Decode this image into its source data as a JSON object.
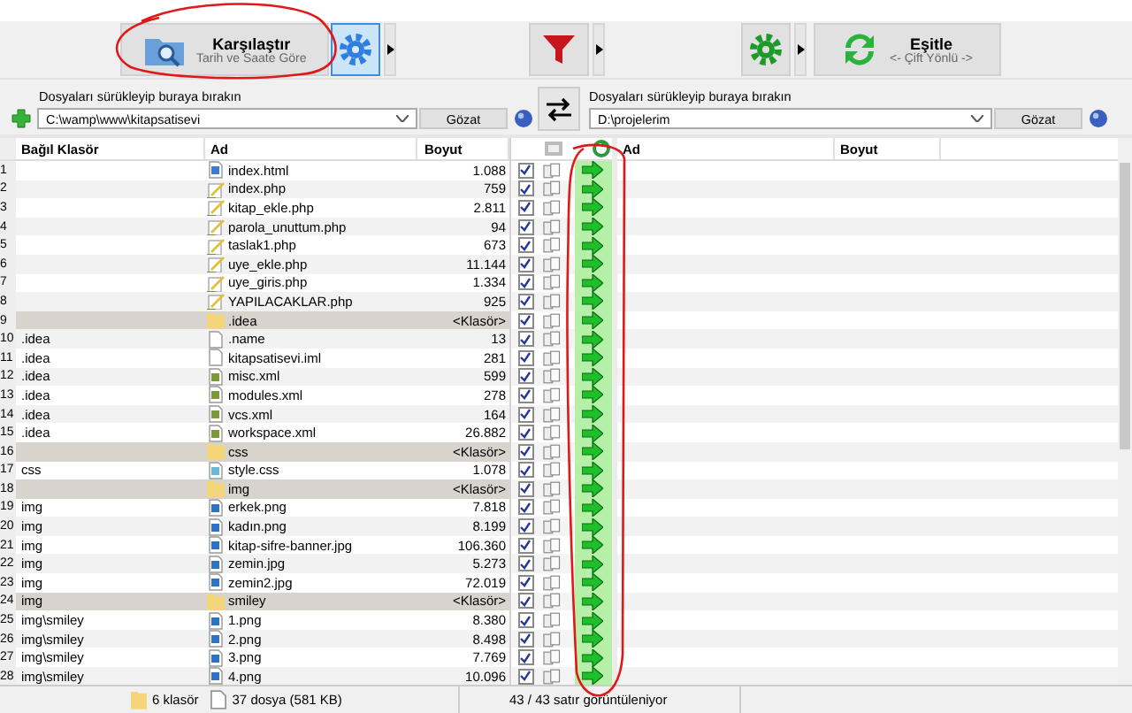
{
  "toolbar": {
    "compare": {
      "title": "Karşılaştır",
      "subtitle": "Tarih ve Saate Göre"
    },
    "sync": {
      "title": "Eşitle",
      "subtitle": "<- Çift Yönlü ->"
    }
  },
  "left_folder": {
    "label": "Dosyaları sürükleyip buraya bırakın",
    "path": "C:\\wamp\\www\\kitapsatisevi",
    "browse": "Gözat"
  },
  "right_folder": {
    "label": "Dosyaları sürükleyip buraya bırakın",
    "path": "D:\\projelerim",
    "browse": "Gözat"
  },
  "left_columns": [
    "Bağıl Klasör",
    "Ad",
    "Boyut"
  ],
  "right_columns": [
    "Ad",
    "Boyut"
  ],
  "rows": [
    {
      "number": "1",
      "folder": "",
      "name": "index.html",
      "size": "1.088",
      "kind": "html",
      "checked": true
    },
    {
      "number": "2",
      "folder": "",
      "name": "index.php",
      "size": "759",
      "kind": "php",
      "checked": true
    },
    {
      "number": "3",
      "folder": "",
      "name": "kitap_ekle.php",
      "size": "2.811",
      "kind": "php",
      "checked": true
    },
    {
      "number": "4",
      "folder": "",
      "name": "parola_unuttum.php",
      "size": "94",
      "kind": "php",
      "checked": true
    },
    {
      "number": "5",
      "folder": "",
      "name": "taslak1.php",
      "size": "673",
      "kind": "php",
      "checked": true
    },
    {
      "number": "6",
      "folder": "",
      "name": "uye_ekle.php",
      "size": "11.144",
      "kind": "php",
      "checked": true
    },
    {
      "number": "7",
      "folder": "",
      "name": "uye_giris.php",
      "size": "1.334",
      "kind": "php",
      "checked": true
    },
    {
      "number": "8",
      "folder": "",
      "name": "YAPILACAKLAR.php",
      "size": "925",
      "kind": "php",
      "checked": true
    },
    {
      "number": "9",
      "folder": "",
      "name": ".idea",
      "size": "<Klasör>",
      "kind": "folder",
      "checked": true
    },
    {
      "number": "10",
      "folder": ".idea",
      "name": ".name",
      "size": "13",
      "kind": "file",
      "checked": true
    },
    {
      "number": "11",
      "folder": ".idea",
      "name": "kitapsatisevi.iml",
      "size": "281",
      "kind": "file",
      "checked": true
    },
    {
      "number": "12",
      "folder": ".idea",
      "name": "misc.xml",
      "size": "599",
      "kind": "xml",
      "checked": true
    },
    {
      "number": "13",
      "folder": ".idea",
      "name": "modules.xml",
      "size": "278",
      "kind": "xml",
      "checked": true
    },
    {
      "number": "14",
      "folder": ".idea",
      "name": "vcs.xml",
      "size": "164",
      "kind": "xml",
      "checked": true
    },
    {
      "number": "15",
      "folder": ".idea",
      "name": "workspace.xml",
      "size": "26.882",
      "kind": "xml",
      "checked": true
    },
    {
      "number": "16",
      "folder": "",
      "name": "css",
      "size": "<Klasör>",
      "kind": "folder",
      "checked": true
    },
    {
      "number": "17",
      "folder": "css",
      "name": "style.css",
      "size": "1.078",
      "kind": "css",
      "checked": true
    },
    {
      "number": "18",
      "folder": "",
      "name": "img",
      "size": "<Klasör>",
      "kind": "folder",
      "checked": true
    },
    {
      "number": "19",
      "folder": "img",
      "name": "erkek.png",
      "size": "7.818",
      "kind": "image",
      "checked": true
    },
    {
      "number": "20",
      "folder": "img",
      "name": "kadın.png",
      "size": "8.199",
      "kind": "image",
      "checked": true
    },
    {
      "number": "21",
      "folder": "img",
      "name": "kitap-sifre-banner.jpg",
      "size": "106.360",
      "kind": "image",
      "checked": true
    },
    {
      "number": "22",
      "folder": "img",
      "name": "zemin.jpg",
      "size": "5.273",
      "kind": "image",
      "checked": true
    },
    {
      "number": "23",
      "folder": "img",
      "name": "zemin2.jpg",
      "size": "72.019",
      "kind": "image",
      "checked": true
    },
    {
      "number": "24",
      "folder": "img",
      "name": "smiley",
      "size": "<Klasör>",
      "kind": "folder",
      "checked": true
    },
    {
      "number": "25",
      "folder": "img\\smiley",
      "name": "1.png",
      "size": "8.380",
      "kind": "image",
      "checked": true
    },
    {
      "number": "26",
      "folder": "img\\smiley",
      "name": "2.png",
      "size": "8.498",
      "kind": "image",
      "checked": true
    },
    {
      "number": "27",
      "folder": "img\\smiley",
      "name": "3.png",
      "size": "7.769",
      "kind": "image",
      "checked": true
    },
    {
      "number": "28",
      "folder": "img\\smiley",
      "name": "4.png",
      "size": "10.096",
      "kind": "image",
      "checked": true
    }
  ],
  "status_bar": {
    "folders": "6 klasör",
    "files": "37 dosya (581 KB)",
    "rows": "43 / 43 satır görüntüleniyor"
  }
}
